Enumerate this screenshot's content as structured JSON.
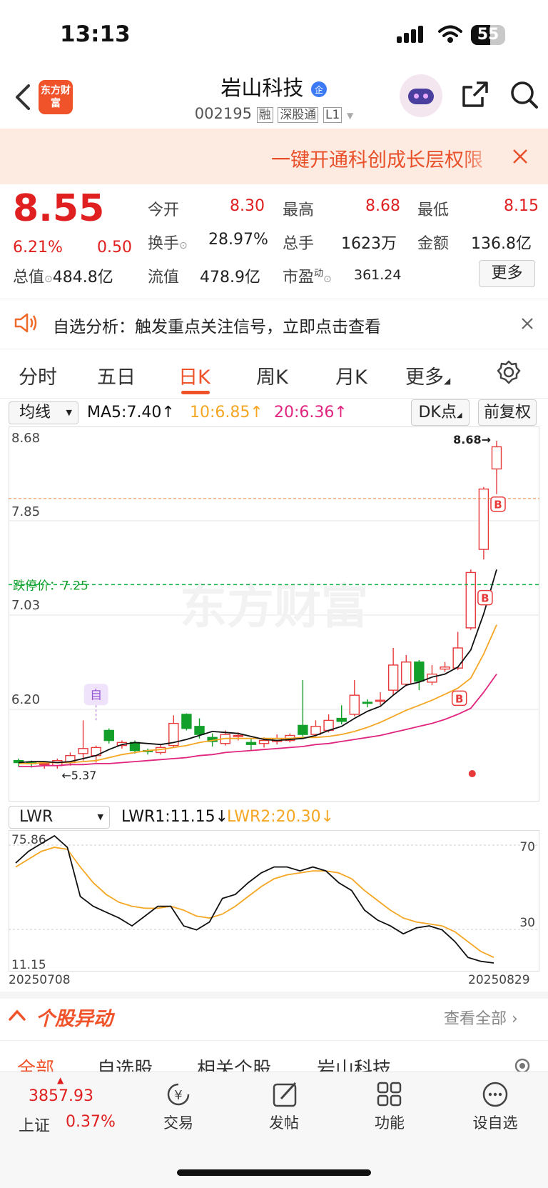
{
  "status_bar": {
    "time": "13:13",
    "battery": "55"
  },
  "header": {
    "logo_text": "东方财富",
    "stock_name": "岩山科技",
    "stock_code": "002195",
    "badges": [
      "融",
      "深股通",
      "L1"
    ]
  },
  "banner": {
    "text": "一键开通科创成长层权限"
  },
  "quote": {
    "price": "8.55",
    "change_pct": "6.21%",
    "change": "0.50",
    "open_label": "今开",
    "open": "8.30",
    "high_label": "最高",
    "high": "8.68",
    "low_label": "最低",
    "low": "8.15",
    "turnover_label": "换手",
    "turnover": "28.97%",
    "volume_label": "总手",
    "volume": "1623万",
    "amount_label": "金额",
    "amount": "136.8亿",
    "mktcap_label": "总值",
    "mktcap": "484.8亿",
    "float_label": "流值",
    "float": "478.9亿",
    "pe_label": "市盈",
    "pe_sup": "动",
    "pe": "361.24",
    "more_label": "更多"
  },
  "notice": {
    "text": "自选分析：触发重点关注信号，立即点击查看"
  },
  "tabs": [
    "分时",
    "五日",
    "日K",
    "周K",
    "月K",
    "更多"
  ],
  "active_tab": "日K",
  "chart_toolbar": {
    "ma_select": "均线",
    "ma5": "MA5:7.40",
    "ma10": "10:6.85",
    "ma20": "20:6.36",
    "dk": "DK点",
    "adjust": "前复权"
  },
  "colors": {
    "up": "#e8393b",
    "down": "#12a02a",
    "ma5": "#111111",
    "ma10": "#f5a623",
    "ma20": "#e0257f",
    "accent": "#f0532a"
  },
  "chart_data": {
    "type": "candlestick",
    "y_ticks": [
      "8.68",
      "7.85",
      "7.03",
      "6.20"
    ],
    "ylim": [
      5.37,
      8.68
    ],
    "max_marker": "8.68→",
    "min_label": "5.37",
    "limit_down_label": "跌停价：",
    "limit_down": "7.25",
    "watermark": "东方财富",
    "self_marker": "自",
    "buy_marker": "B",
    "candles": [
      {
        "o": 5.5,
        "c": 5.48,
        "h": 5.52,
        "l": 5.44
      },
      {
        "o": 5.48,
        "c": 5.47,
        "h": 5.5,
        "l": 5.43
      },
      {
        "o": 5.47,
        "c": 5.47,
        "h": 5.49,
        "l": 5.42
      },
      {
        "o": 5.45,
        "c": 5.5,
        "h": 5.52,
        "l": 5.42
      },
      {
        "o": 5.48,
        "c": 5.55,
        "h": 5.58,
        "l": 5.45
      },
      {
        "o": 5.57,
        "c": 5.62,
        "h": 5.9,
        "l": 5.5
      },
      {
        "o": 5.55,
        "c": 5.63,
        "h": 5.65,
        "l": 5.48
      },
      {
        "o": 5.8,
        "c": 5.7,
        "h": 5.82,
        "l": 5.67
      },
      {
        "o": 5.65,
        "c": 5.68,
        "h": 5.7,
        "l": 5.62
      },
      {
        "o": 5.68,
        "c": 5.6,
        "h": 5.7,
        "l": 5.57
      },
      {
        "o": 5.6,
        "c": 5.59,
        "h": 5.62,
        "l": 5.56
      },
      {
        "o": 5.58,
        "c": 5.63,
        "h": 5.66,
        "l": 5.56
      },
      {
        "o": 5.65,
        "c": 5.87,
        "h": 5.95,
        "l": 5.63
      },
      {
        "o": 5.96,
        "c": 5.82,
        "h": 5.97,
        "l": 5.8
      },
      {
        "o": 5.84,
        "c": 5.76,
        "h": 5.92,
        "l": 5.72
      },
      {
        "o": 5.73,
        "c": 5.69,
        "h": 5.77,
        "l": 5.64
      },
      {
        "o": 5.67,
        "c": 5.76,
        "h": 5.8,
        "l": 5.65
      },
      {
        "o": 5.74,
        "c": 5.75,
        "h": 5.78,
        "l": 5.7
      },
      {
        "o": 5.68,
        "c": 5.66,
        "h": 5.72,
        "l": 5.6
      },
      {
        "o": 5.67,
        "c": 5.7,
        "h": 5.73,
        "l": 5.63
      },
      {
        "o": 5.69,
        "c": 5.72,
        "h": 5.76,
        "l": 5.66
      },
      {
        "o": 5.7,
        "c": 5.75,
        "h": 5.77,
        "l": 5.68
      },
      {
        "o": 5.85,
        "c": 5.76,
        "h": 6.3,
        "l": 5.74
      },
      {
        "o": 5.76,
        "c": 5.84,
        "h": 5.9,
        "l": 5.74
      },
      {
        "o": 5.8,
        "c": 5.9,
        "h": 5.96,
        "l": 5.78
      },
      {
        "o": 5.92,
        "c": 5.89,
        "h": 6.05,
        "l": 5.86
      },
      {
        "o": 5.96,
        "c": 6.15,
        "h": 6.3,
        "l": 5.94
      },
      {
        "o": 6.08,
        "c": 6.07,
        "h": 6.11,
        "l": 6.03
      },
      {
        "o": 6.1,
        "c": 6.1,
        "h": 6.18,
        "l": 6.05
      },
      {
        "o": 6.2,
        "c": 6.45,
        "h": 6.62,
        "l": 6.15
      },
      {
        "o": 6.26,
        "c": 6.48,
        "h": 6.55,
        "l": 6.24
      },
      {
        "o": 6.48,
        "c": 6.29,
        "h": 6.5,
        "l": 6.2
      },
      {
        "o": 6.28,
        "c": 6.36,
        "h": 6.45,
        "l": 6.25
      },
      {
        "o": 6.41,
        "c": 6.43,
        "h": 6.48,
        "l": 6.38
      },
      {
        "o": 6.42,
        "c": 6.62,
        "h": 6.78,
        "l": 6.4
      },
      {
        "o": 6.82,
        "c": 7.37,
        "h": 7.4,
        "l": 6.8
      },
      {
        "o": 7.6,
        "c": 8.2,
        "h": 8.22,
        "l": 7.5
      },
      {
        "o": 8.4,
        "c": 8.62,
        "h": 8.68,
        "l": 8.15
      }
    ],
    "ma5": [
      5.48,
      5.49,
      5.49,
      5.48,
      5.49,
      5.52,
      5.55,
      5.61,
      5.66,
      5.68,
      5.67,
      5.66,
      5.68,
      5.71,
      5.75,
      5.79,
      5.78,
      5.77,
      5.74,
      5.71,
      5.7,
      5.71,
      5.72,
      5.75,
      5.8,
      5.84,
      5.92,
      5.99,
      6.04,
      6.15,
      6.25,
      6.28,
      6.33,
      6.36,
      6.43,
      6.6,
      6.96,
      7.4
    ],
    "ma10": [
      5.47,
      5.47,
      5.48,
      5.48,
      5.48,
      5.49,
      5.5,
      5.53,
      5.56,
      5.58,
      5.6,
      5.61,
      5.63,
      5.65,
      5.68,
      5.7,
      5.72,
      5.72,
      5.72,
      5.72,
      5.72,
      5.72,
      5.73,
      5.73,
      5.74,
      5.76,
      5.79,
      5.83,
      5.88,
      5.94,
      6.0,
      6.05,
      6.1,
      6.16,
      6.22,
      6.32,
      6.56,
      6.85
    ],
    "ma20": [
      5.44,
      5.44,
      5.45,
      5.45,
      5.46,
      5.46,
      5.47,
      5.47,
      5.48,
      5.49,
      5.5,
      5.51,
      5.52,
      5.53,
      5.55,
      5.56,
      5.58,
      5.59,
      5.6,
      5.61,
      5.62,
      5.63,
      5.64,
      5.66,
      5.67,
      5.69,
      5.71,
      5.73,
      5.75,
      5.78,
      5.81,
      5.84,
      5.87,
      5.91,
      5.96,
      6.02,
      6.18,
      6.36
    ],
    "indicator": {
      "name": "LWR",
      "lwr1_label": "LWR1:11.15",
      "lwr2_label": "LWR2:20.30",
      "top_left": "75.86",
      "bottom_left": "11.15",
      "right_ticks": [
        "70",
        "30"
      ],
      "ylim": [
        11.15,
        75.86
      ],
      "lwr1": [
        62,
        68,
        72,
        75.86,
        70,
        45,
        40,
        37,
        34,
        30,
        35,
        40,
        40,
        30,
        28,
        32,
        44,
        46,
        52,
        57,
        60,
        60,
        58,
        60,
        58,
        52,
        48,
        38,
        33,
        30,
        26,
        29,
        30,
        28,
        22,
        14,
        12,
        11.15
      ],
      "lwr2": [
        60,
        64,
        68,
        70,
        69,
        60,
        52,
        46,
        42,
        40,
        39,
        39,
        40,
        38,
        35,
        34,
        36,
        40,
        45,
        50,
        54,
        56,
        57,
        58,
        58,
        57,
        54,
        48,
        43,
        38,
        34,
        32,
        31,
        30,
        27,
        22,
        17,
        14
      ]
    },
    "x_labels": [
      "20250708",
      "20250829"
    ]
  },
  "movement": {
    "title": "个股异动",
    "view_all": "查看全部",
    "subtabs": [
      "全部",
      "自选股",
      "相关个股",
      "岩山科技"
    ]
  },
  "bottom_nav": {
    "index_value": "3857.93",
    "index_name": "上证",
    "index_change": "0.37%",
    "items": [
      "交易",
      "发帖",
      "功能",
      "设自选"
    ]
  }
}
